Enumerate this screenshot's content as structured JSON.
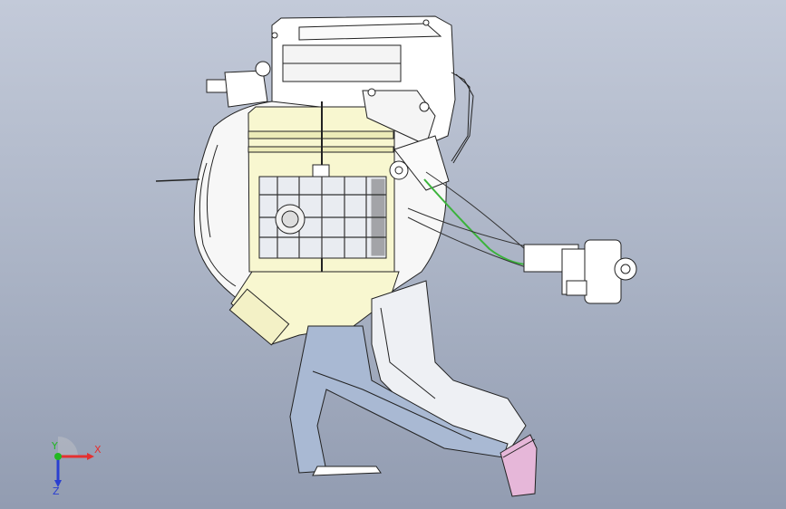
{
  "viewport": {
    "background_top": "#c3cad9",
    "background_bottom": "#929cb1",
    "model_colors": {
      "housing": "#ffffff",
      "blower_cover": "#f8f7d0",
      "duct_blue": "#a9b9d3",
      "wire_green": "#3bb33b",
      "flange_pink": "#e6b7d9",
      "outline": "#222222"
    }
  },
  "triad": {
    "x_label": "X",
    "y_label": "Y",
    "z_label": "Z",
    "x_color": "#e53030",
    "y_color": "#22b822",
    "z_color": "#2a3fd1"
  }
}
